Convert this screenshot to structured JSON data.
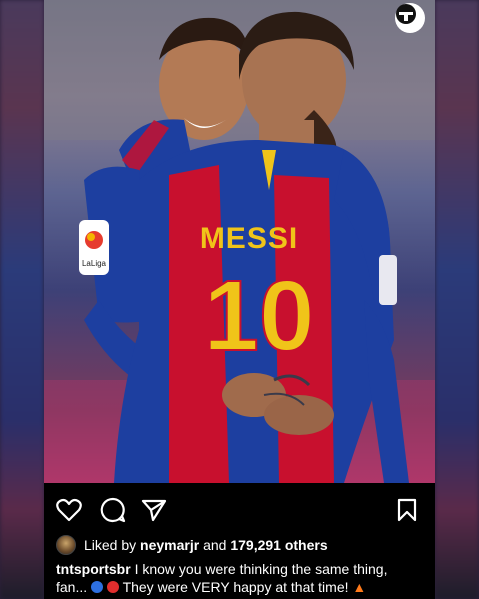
{
  "post": {
    "jersey_name": "MESSI",
    "jersey_number": "10",
    "sleeve_badge": "LaLiga",
    "likes": {
      "prefix": "Liked by",
      "user": "neymarjr",
      "joiner": "and",
      "count": "179,291 others"
    },
    "caption": {
      "user": "tntsportsbr",
      "line1": "I know you were thinking the same thing,",
      "line2_a": "fan...",
      "line2_b": "They were VERY happy at that time!"
    }
  },
  "icons": {
    "like": "heart-icon",
    "comment": "comment-icon",
    "share": "send-icon",
    "save": "bookmark-icon",
    "brand": "tnt-logo-icon"
  },
  "colors": {
    "blaugrana_red": "#c8102e",
    "blaugrana_blue": "#1d3fa0",
    "jersey_gold": "#f0c419"
  }
}
